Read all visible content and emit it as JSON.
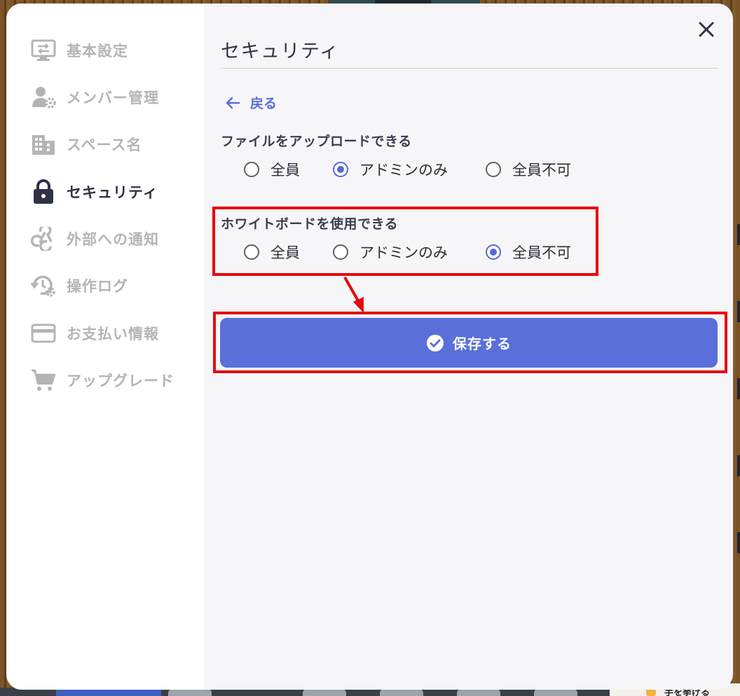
{
  "sidebar": {
    "items": [
      {
        "label": "基本設定",
        "icon": "settings-toggle-icon",
        "active": false
      },
      {
        "label": "メンバー管理",
        "icon": "user-gear-icon",
        "active": false
      },
      {
        "label": "スペース名",
        "icon": "building-icon",
        "active": false
      },
      {
        "label": "セキュリティ",
        "icon": "lock-icon",
        "active": true
      },
      {
        "label": "外部への通知",
        "icon": "webhook-icon",
        "active": false
      },
      {
        "label": "操作ログ",
        "icon": "history-gear-icon",
        "active": false
      },
      {
        "label": "お支払い情報",
        "icon": "credit-card-icon",
        "active": false
      },
      {
        "label": "アップグレード",
        "icon": "cart-icon",
        "active": false
      }
    ]
  },
  "main": {
    "title": "セキュリティ",
    "back_label": "戻る",
    "close_icon": "close-icon",
    "file_upload": {
      "label": "ファイルをアップロードできる",
      "options": [
        "全員",
        "アドミンのみ",
        "全員不可"
      ],
      "selected": "アドミンのみ"
    },
    "whiteboard": {
      "label": "ホワイトボードを使用できる",
      "options": [
        "全員",
        "アドミンのみ",
        "全員不可"
      ],
      "selected": "全員不可"
    },
    "save_label": "保存する"
  },
  "background": {
    "raise_hand_label": "手を挙げる"
  },
  "colors": {
    "accent": "#5a6fd9",
    "annotation": "#e6070d",
    "active_text": "#2f3246",
    "inactive_text": "#b4b4b8"
  }
}
